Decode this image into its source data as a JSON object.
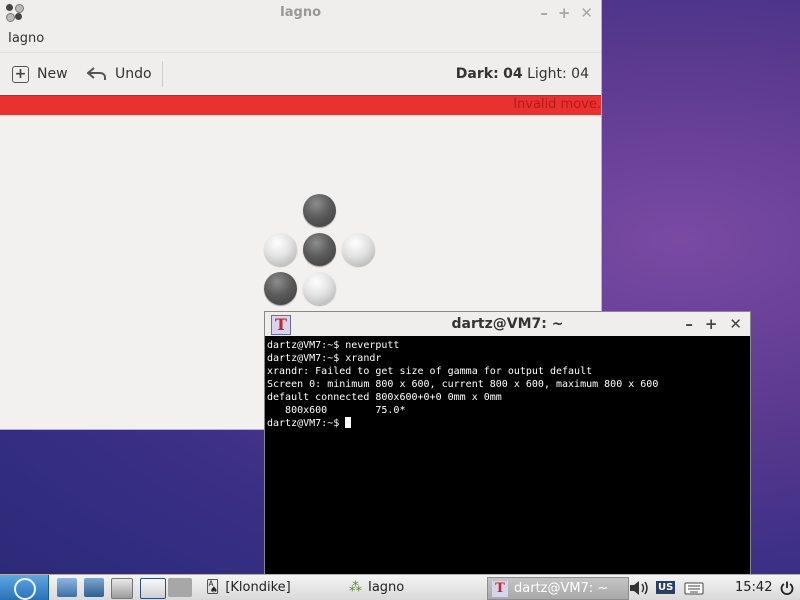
{
  "iagno": {
    "title": "Iagno",
    "app_menu": "Iagno",
    "toolbar": {
      "new_label": "New",
      "undo_label": "Undo"
    },
    "score": {
      "dark_label": "Dark:",
      "dark_value": "04",
      "light_label": "Light:",
      "light_value": "04"
    },
    "infobar_message": "Invalid move.",
    "board": {
      "discs": [
        {
          "row": 0,
          "col": 1,
          "color": "dark"
        },
        {
          "row": 1,
          "col": 0,
          "color": "light"
        },
        {
          "row": 1,
          "col": 1,
          "color": "dark"
        },
        {
          "row": 1,
          "col": 2,
          "color": "light"
        },
        {
          "row": 2,
          "col": 0,
          "color": "dark"
        },
        {
          "row": 2,
          "col": 1,
          "color": "light"
        }
      ]
    }
  },
  "terminal": {
    "title": "dartz@VM7: ~",
    "lines": [
      "dartz@VM7:~$ neverputt",
      "dartz@VM7:~$ xrandr",
      "xrandr: Failed to get size of gamma for output default",
      "Screen 0: minimum 800 x 600, current 800 x 600, maximum 800 x 600",
      "default connected 800x600+0+0 0mm x 0mm",
      "   800x600        75.0*",
      "dartz@VM7:~$ "
    ]
  },
  "taskbar": {
    "tasks": [
      {
        "label": "[Klondike]"
      },
      {
        "label": "Iagno"
      },
      {
        "label": "dartz@VM7: ~"
      }
    ],
    "keyboard_layout": "US",
    "clock": "15:42"
  },
  "colors": {
    "infobar_bg": "#e9322f",
    "terminal_bg": "#000000",
    "accent": "#2a72b8"
  }
}
